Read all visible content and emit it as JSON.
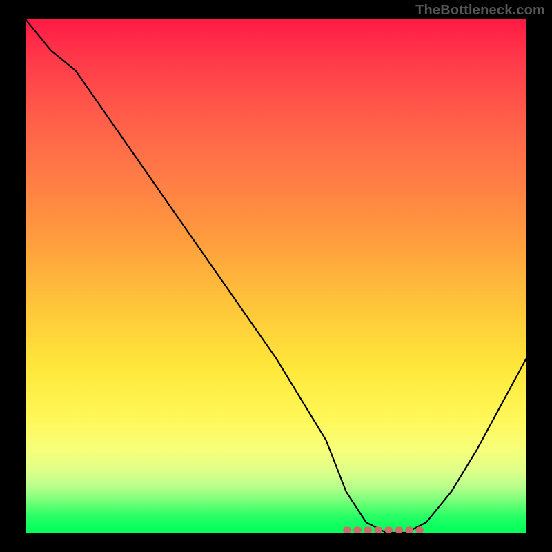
{
  "watermark": "TheBottleneck.com",
  "chart_data": {
    "type": "line",
    "title": "",
    "xlabel": "",
    "ylabel": "",
    "xlim": [
      0,
      100
    ],
    "ylim": [
      0,
      100
    ],
    "series": [
      {
        "name": "bottleneck-curve",
        "x": [
          0,
          5,
          10,
          20,
          30,
          40,
          50,
          60,
          64,
          68,
          72,
          76,
          80,
          85,
          90,
          95,
          100
        ],
        "y": [
          100,
          94,
          90,
          76,
          62,
          48,
          34,
          18,
          8,
          2,
          0,
          0,
          2,
          8,
          16,
          25,
          34
        ]
      }
    ],
    "annotations": [
      {
        "name": "flat-minimum-marker",
        "x_range": [
          64,
          80
        ],
        "y": 0,
        "style": "dotted-salmon"
      }
    ],
    "background": {
      "type": "vertical-gradient",
      "stops": [
        {
          "pos": 0.0,
          "color": "#ff1a44"
        },
        {
          "pos": 0.3,
          "color": "#ff7a46"
        },
        {
          "pos": 0.55,
          "color": "#ffc33a"
        },
        {
          "pos": 0.78,
          "color": "#fff85a"
        },
        {
          "pos": 0.95,
          "color": "#57ff70"
        },
        {
          "pos": 1.0,
          "color": "#06ff56"
        }
      ]
    }
  }
}
